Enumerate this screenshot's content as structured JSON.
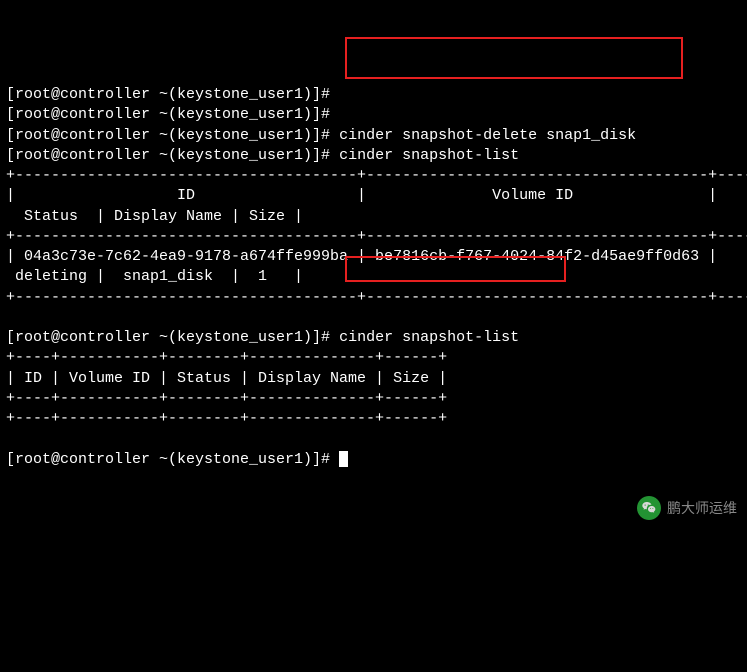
{
  "prompt": "[root@controller ~(keystone_user1)]#",
  "commands": {
    "blank": "",
    "snapshot_delete": "cinder snapshot-delete snap1_disk",
    "snapshot_list": "cinder snapshot-list"
  },
  "table1": {
    "border_top": "+--------------------------------------+--------------------------------------+----------+--------------+------+",
    "header_line1": "|                  ID                  |              Volume ID               |",
    "header_line2": "  Status  | Display Name | Size |",
    "header_sep": "+--------------------------------------+--------------------------------------+----------+--------------+------+",
    "row_line1": "| 04a3c73e-7c62-4ea9-9178-a674ffe999ba | be7816cb-f767-4024-84f2-d45ae9ff0d63 |",
    "row_line2": " deleting |  snap1_disk  |  1   |",
    "border_bottom": "+--------------------------------------+--------------------------------------+----------+--------------+------+"
  },
  "table2": {
    "border_top": "+----+-----------+--------+--------------+------+",
    "header": "| ID | Volume ID | Status | Display Name | Size |",
    "header_sep": "+----+-----------+--------+--------------+------+",
    "border_bottom": "+----+-----------+--------+--------------+------+"
  },
  "blank_line": "",
  "watermark": {
    "text": "鹏大师运维"
  }
}
